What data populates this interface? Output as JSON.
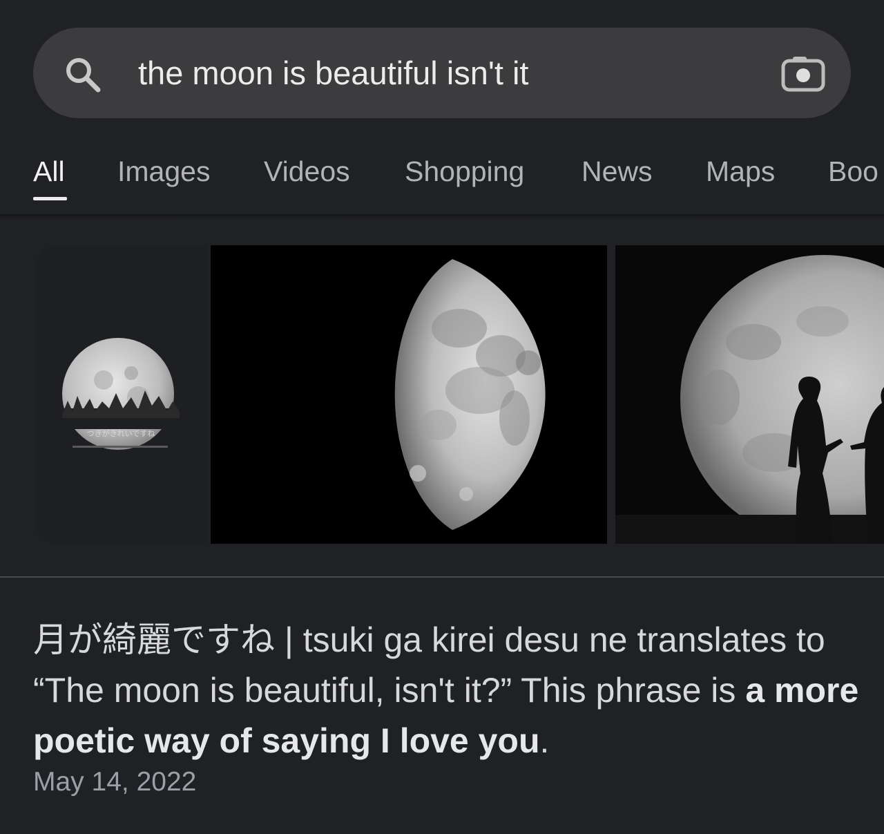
{
  "search": {
    "query": "the moon is beautiful isn't it",
    "icon": "search-icon",
    "camera_icon": "camera-icon"
  },
  "tabs": [
    {
      "label": "All",
      "active": true
    },
    {
      "label": "Images",
      "active": false
    },
    {
      "label": "Videos",
      "active": false
    },
    {
      "label": "Shopping",
      "active": false
    },
    {
      "label": "News",
      "active": false
    },
    {
      "label": "Maps",
      "active": false
    },
    {
      "label": "Boo",
      "active": false
    }
  ],
  "images": {
    "thumb1_caption": "つきがきれいですね"
  },
  "snippet": {
    "text_part1": "月が綺麗ですね | tsuki ga kirei desu ne translates to “The moon is beautiful, isn't it?” This phrase is ",
    "text_bold": "a more poetic way of saying I love you",
    "text_end": ".",
    "date": "May 14, 2022"
  },
  "colors": {
    "background": "#202124",
    "search_bar": "#3c3c3e",
    "tab_inactive": "#b1b3b8",
    "tab_active": "#f1f1f1",
    "date": "#9aa0a6"
  }
}
